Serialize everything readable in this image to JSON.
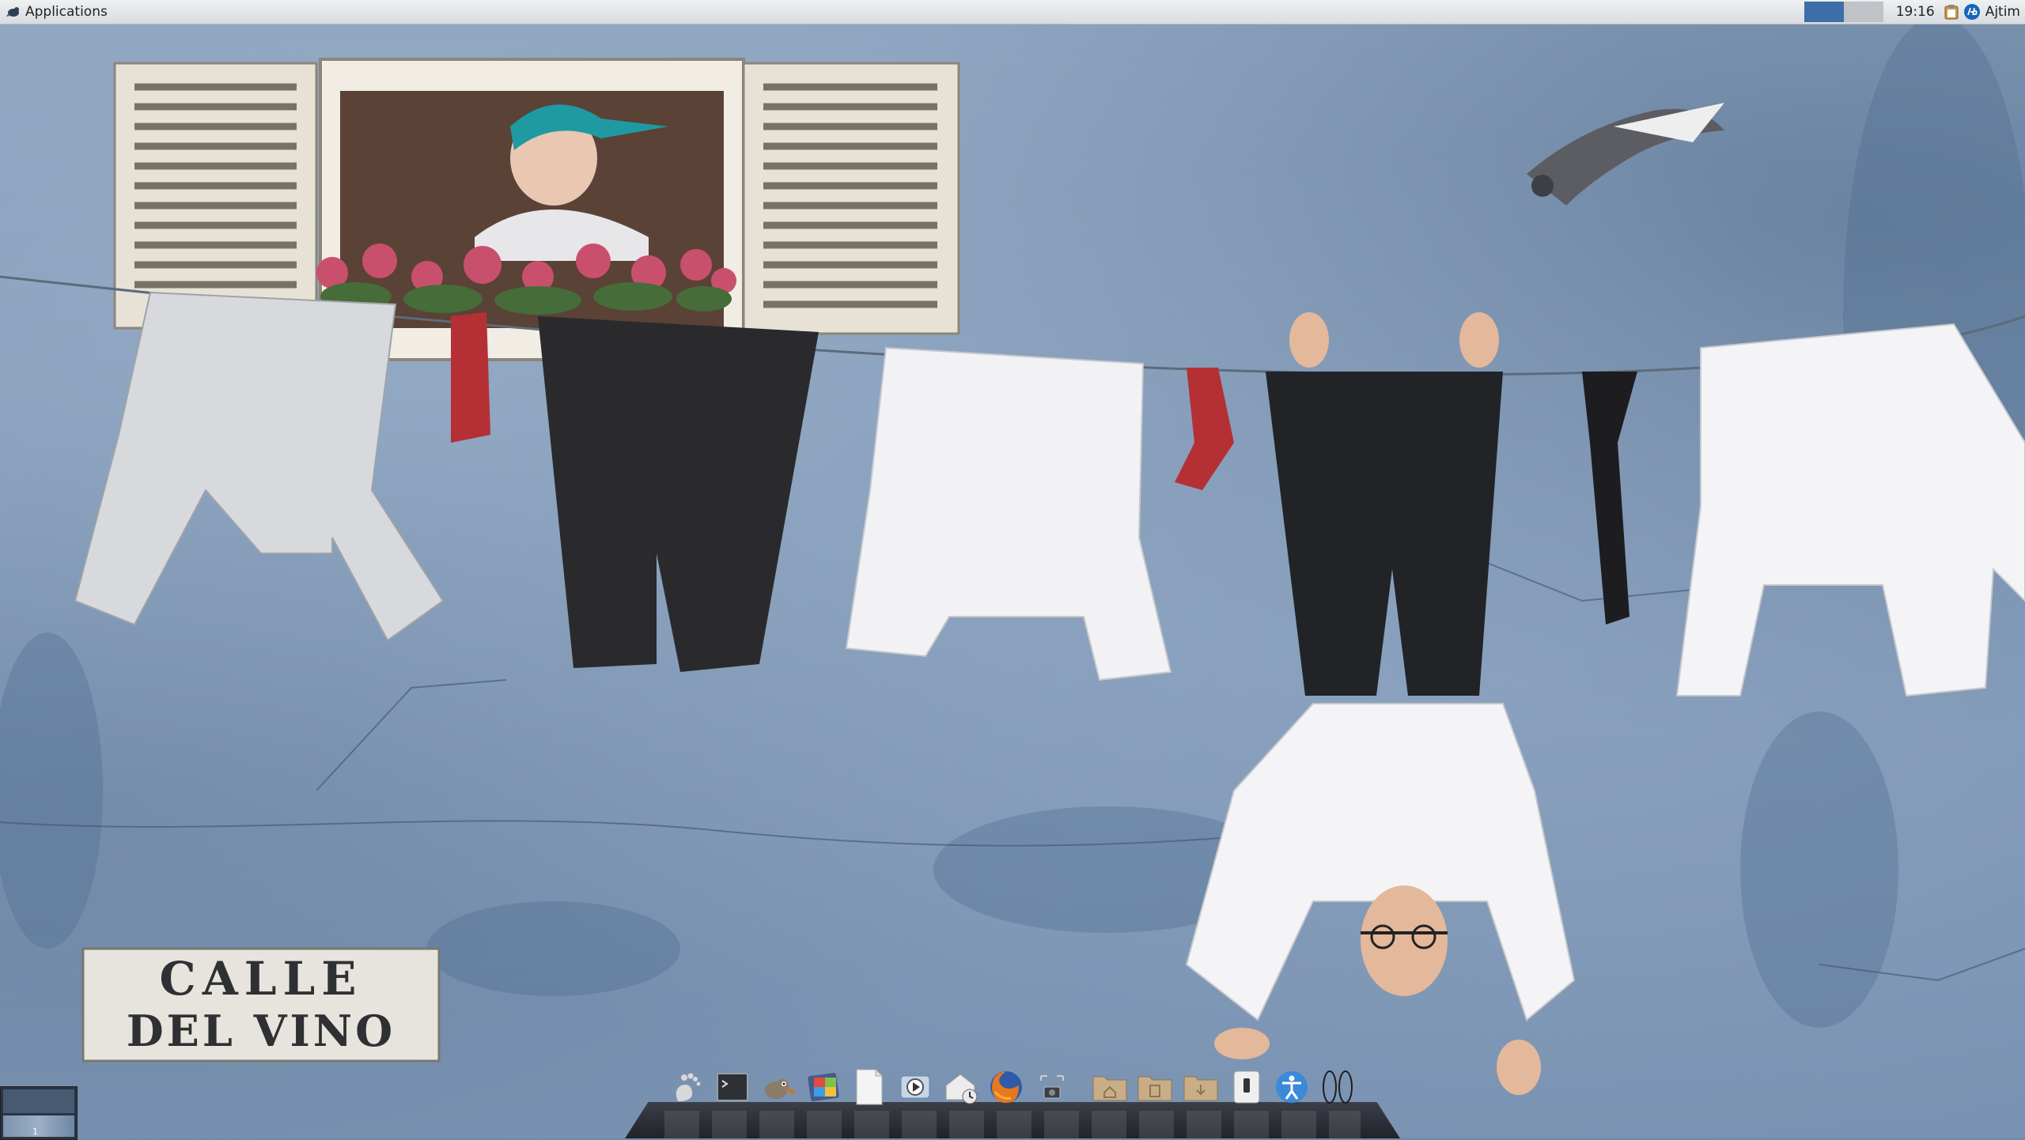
{
  "top_panel": {
    "applications_label": "Applications",
    "clock": "19:16",
    "user": "Ajtim",
    "workspaces": [
      {
        "active": true
      },
      {
        "active": false
      }
    ],
    "tray_icons": [
      "clipboard-icon",
      "hp-icon"
    ]
  },
  "wallpaper": {
    "sign_line1": "CALLE",
    "sign_line2": "DEL VINO"
  },
  "pager": {
    "workspace_number": "1"
  },
  "dock": {
    "items": [
      {
        "icon": "gnome-foot-icon"
      },
      {
        "icon": "terminal-icon"
      },
      {
        "icon": "gimp-icon"
      },
      {
        "icon": "image-viewer-icon"
      },
      {
        "icon": "text-file-icon"
      },
      {
        "icon": "media-player-icon"
      },
      {
        "icon": "mail-icon"
      },
      {
        "icon": "firefox-icon"
      },
      {
        "icon": "screenshot-icon"
      },
      {
        "icon": "home-folder-icon"
      },
      {
        "icon": "documents-folder-icon"
      },
      {
        "icon": "downloads-folder-icon"
      },
      {
        "icon": "phone-icon"
      },
      {
        "icon": "accessibility-icon"
      },
      {
        "icon": "workspace-indicator-icon"
      }
    ]
  },
  "colors": {
    "panel_bg": "#e4e6e8",
    "workspace_active": "#3e6ea8",
    "wall_blue": "#7d97b5",
    "dock_bg": "#2a2d34"
  }
}
